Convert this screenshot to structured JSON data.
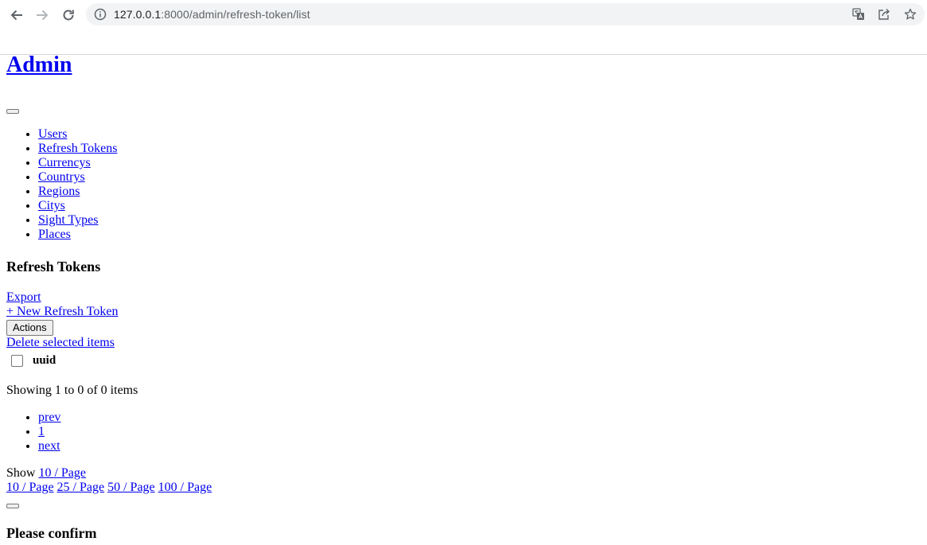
{
  "browser": {
    "url_host": "127.0.0.1",
    "url_rest": ":8000/admin/refresh-token/list",
    "icons": [
      "back-arrow-icon",
      "forward-arrow-icon",
      "reload-icon",
      "info-icon",
      "translate-icon",
      "share-icon",
      "bookmark-star-icon"
    ]
  },
  "brand": "Admin",
  "sidebar": {
    "items": [
      {
        "label": "Users"
      },
      {
        "label": "Refresh Tokens"
      },
      {
        "label": "Currencys"
      },
      {
        "label": "Countrys"
      },
      {
        "label": "Regions"
      },
      {
        "label": "Citys"
      },
      {
        "label": "Sight Types"
      },
      {
        "label": "Places"
      }
    ]
  },
  "main": {
    "title": "Refresh Tokens",
    "export_label": "Export",
    "new_label": "+ New Refresh Token",
    "actions_label": "Actions",
    "delete_selected_label": "Delete selected items",
    "table": {
      "columns": [
        "uuid"
      ],
      "rows": []
    },
    "showing_text": "Showing 1 to 0 of 0 items",
    "pagination": {
      "prev": "prev",
      "pages": [
        "1"
      ],
      "next": "next"
    },
    "page_size": {
      "show_label": "Show",
      "current": "10 / Page",
      "options": [
        "10 / Page",
        "25 / Page",
        "50 / Page",
        "100 / Page"
      ]
    }
  },
  "modal": {
    "title": "Please confirm"
  }
}
